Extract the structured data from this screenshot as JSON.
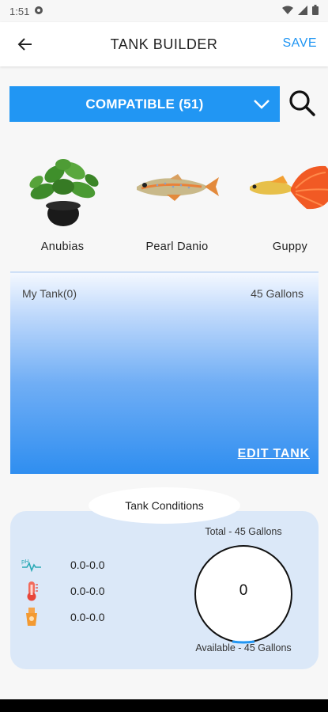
{
  "status_bar": {
    "time": "1:51"
  },
  "app_bar": {
    "title": "TANK BUILDER",
    "save_label": "SAVE"
  },
  "filter": {
    "selected": "COMPATIBLE (51)"
  },
  "species": [
    {
      "name": "Anubias",
      "icon": "anubias-plant"
    },
    {
      "name": "Pearl Danio",
      "icon": "pearl-danio-fish"
    },
    {
      "name": "Guppy",
      "icon": "guppy-fish"
    }
  ],
  "tank": {
    "name": "My Tank(0)",
    "volume": "45 Gallons",
    "edit_label": "EDIT TANK"
  },
  "conditions": {
    "title": "Tank Conditions",
    "ph_range": "0.0-0.0",
    "temperature_range": "0.0-0.0",
    "hardness_range": "0.0-0.0",
    "total_label": "Total - 45 Gallons",
    "gauge_value": "0",
    "available_label": "Available - 45 Gallons",
    "used_fraction": 0
  },
  "colors": {
    "accent": "#2196f3",
    "card_bg": "#dbe8f8",
    "tank_gradient_bottom": "#2f8ef0"
  }
}
